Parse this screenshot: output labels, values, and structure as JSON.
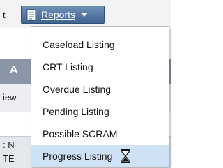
{
  "toolbar": {
    "left_fragment": "t",
    "reports_label": "Reports",
    "reports_icon": "document-icon",
    "dropdown_icon": "chevron-down-icon"
  },
  "background": {
    "fragment_a": "A",
    "fragment_b": "iew",
    "fragment_c": ": N",
    "fragment_d": "TE"
  },
  "menu": {
    "items": [
      {
        "label": "Caseload Listing"
      },
      {
        "label": "CRT Listing"
      },
      {
        "label": "Overdue Listing"
      },
      {
        "label": "Pending Listing"
      },
      {
        "label": "Possible SCRAM"
      },
      {
        "label": "Progress Listing",
        "selected": true
      }
    ],
    "cursor_icon": "hourglass-icon"
  },
  "colors": {
    "button_gradient_top": "#6f8fb6",
    "button_gradient_bottom": "#3f6593",
    "highlight": "#cfe1f5"
  }
}
